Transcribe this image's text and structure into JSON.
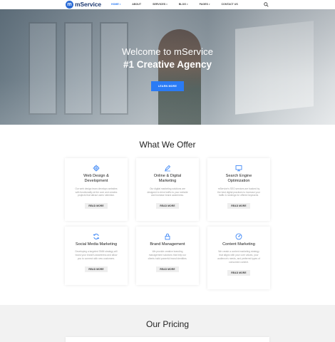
{
  "brand": {
    "mark": "m",
    "name": "mService",
    "accent": "#2a7bf5"
  },
  "nav": {
    "items": [
      {
        "label": "HOME",
        "caret": "▾"
      },
      {
        "label": "ABOUT",
        "caret": ""
      },
      {
        "label": "SERVICES",
        "caret": "▾"
      },
      {
        "label": "BLOG",
        "caret": "▾"
      },
      {
        "label": "PAGES",
        "caret": "▾"
      },
      {
        "label": "CONTACT US",
        "caret": ""
      }
    ],
    "search_icon": "search-icon"
  },
  "hero": {
    "title": "Welcome to mService",
    "subtitle": "#1 Creative Agency",
    "button": "LEARN MORE"
  },
  "offer": {
    "title": "What We Offer",
    "cards": [
      {
        "icon": "gear-icon",
        "title": "Web Design & Development",
        "desc": "Our web design team develops websites with functionality at the core and creates projects that attract users' attention.",
        "button": "READ MORE"
      },
      {
        "icon": "pen-icon",
        "title": "Online & Digital Marketing",
        "desc": "Our digital marketing solutions are designed to drive traffic to your website and increase brand awareness.",
        "button": "READ MORE"
      },
      {
        "icon": "monitor-icon",
        "title": "Search Engine Optimization",
        "desc": "mService's SEO services are backed by the best digital practices to increase your traffic & rankings for offered keywords.",
        "button": "READ MORE"
      },
      {
        "icon": "refresh-icon",
        "title": "Social Media Marketing",
        "desc": "Developing a targeted SMM strategy will boost your brand's awareness and allow you to connect with new customers.",
        "button": "READ MORE"
      },
      {
        "icon": "lock-icon",
        "title": "Brand Management",
        "desc": "We provide creative branding management solutions that help our clients build powerful brand identities.",
        "button": "READ MORE"
      },
      {
        "icon": "gauge-icon",
        "title": "Content Marketing",
        "desc": "We create a content marketing strategy that aligns with your core values, your audience's needs, and preferred types of consumed content.",
        "button": "READ MORE"
      }
    ]
  },
  "pricing": {
    "title": "Our Pricing"
  }
}
